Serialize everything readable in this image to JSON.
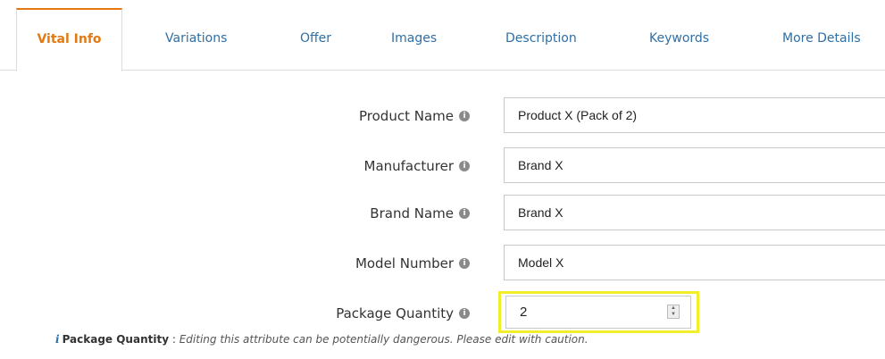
{
  "tabs": [
    {
      "label": "Vital Info",
      "active": true
    },
    {
      "label": "Variations",
      "active": false
    },
    {
      "label": "Offer",
      "active": false
    },
    {
      "label": "Images",
      "active": false
    },
    {
      "label": "Description",
      "active": false
    },
    {
      "label": "Keywords",
      "active": false
    },
    {
      "label": "More Details",
      "active": false
    }
  ],
  "fields": {
    "product_name": {
      "label": "Product Name",
      "value": "Product X (Pack of 2)"
    },
    "manufacturer": {
      "label": "Manufacturer",
      "value": "Brand X"
    },
    "brand_name": {
      "label": "Brand Name",
      "value": "Brand X"
    },
    "model_number": {
      "label": "Model Number",
      "value": "Model X"
    },
    "package_quantity": {
      "label": "Package Quantity",
      "value": "2"
    }
  },
  "info_glyph": "i",
  "warning": {
    "icon": "i",
    "label": "Package Quantity",
    "separator": " : ",
    "text": "Editing this attribute can be potentially dangerous. Please edit with caution."
  },
  "colors": {
    "active_tab": "#e47911",
    "tab_link": "#2f6fa6",
    "highlight": "#f3ee2a"
  }
}
